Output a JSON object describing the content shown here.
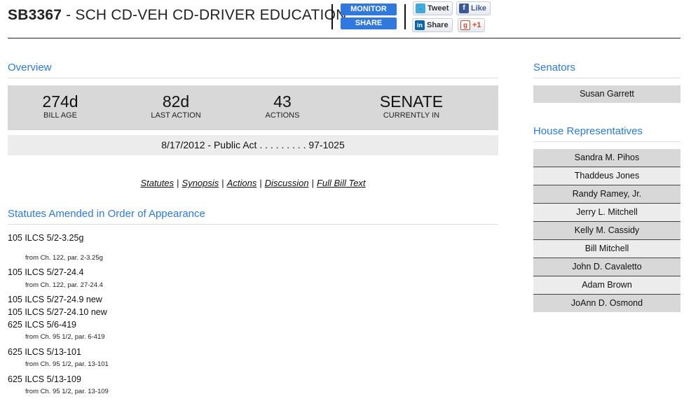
{
  "bill": {
    "code": "SB3367",
    "title_rest": " - SCH CD-VEH CD-DRIVER EDUCATION"
  },
  "header_buttons": {
    "monitor": "MONITOR",
    "share": "SHARE"
  },
  "social": {
    "tweet": "Tweet",
    "like": "Like",
    "linkedin": "Share",
    "gplus": "+1"
  },
  "overview": {
    "heading": "Overview",
    "stats": [
      {
        "value": "274d",
        "label": "BILL AGE"
      },
      {
        "value": "82d",
        "label": "LAST ACTION"
      },
      {
        "value": "43",
        "label": "ACTIONS"
      },
      {
        "value": "SENATE",
        "label": "CURRENTLY IN"
      }
    ],
    "latest_action": "8/17/2012 - Public Act . . . . . . . . . 97-1025"
  },
  "links": [
    "Statutes",
    "Synopsis",
    "Actions",
    "Discussion",
    "Full Bill Text"
  ],
  "statutes": {
    "heading": "Statutes Amended in Order of Appearance",
    "items": [
      {
        "cite": "105 ILCS 5/2-3.25g",
        "from": "from Ch. 122, par. 2-3.25g"
      },
      {
        "cite": "105 ILCS 5/27-24.4",
        "from": "from Ch. 122, par. 27-24.4"
      },
      {
        "cite": "105 ILCS 5/27-24.9 new",
        "from": ""
      },
      {
        "cite": "105 ILCS 5/27-24.10 new",
        "from": ""
      },
      {
        "cite": "625 ILCS 5/6-419",
        "from": "from Ch. 95 1/2, par. 6-419"
      },
      {
        "cite": "625 ILCS 5/13-101",
        "from": "from Ch. 95 1/2, par. 13-101"
      },
      {
        "cite": "625 ILCS 5/13-109",
        "from": "from Ch. 95 1/2, par. 13-109"
      }
    ]
  },
  "senators": {
    "heading": "Senators",
    "items": [
      "Susan Garrett"
    ]
  },
  "house": {
    "heading": "House Representatives",
    "items": [
      "Sandra M. Pihos",
      "Thaddeus Jones",
      "Randy Ramey, Jr.",
      "Jerry L. Mitchell",
      "Kelly M. Cassidy",
      "Bill Mitchell",
      "John D. Cavaletto",
      "Adam Brown",
      "JoAnn D. Osmond"
    ]
  },
  "colors": {
    "accent_blue": "#2a7ae2",
    "button_blue": "#2e78de",
    "panel_gray": "#d8d8d8",
    "panel_light": "#ececec"
  }
}
